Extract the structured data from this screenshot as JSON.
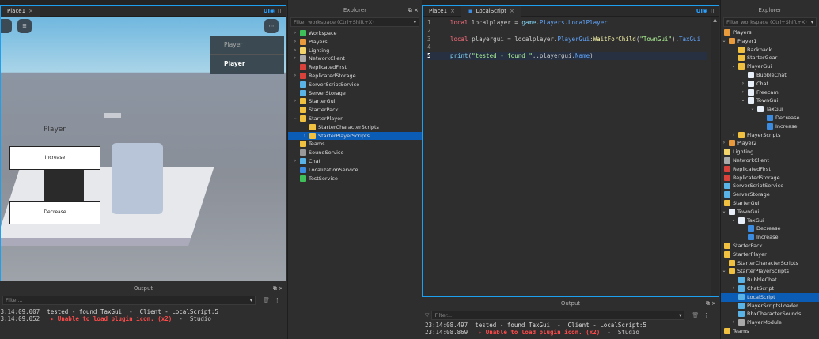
{
  "viewport": {
    "tab": "Place1",
    "ui_label": "UI",
    "menu_items": [
      "Player",
      "Player"
    ],
    "player_label": "Player",
    "buttons": {
      "increase": "Increase",
      "decrease": "Decrease"
    }
  },
  "explorer_mid": {
    "title": "Explorer",
    "filter_placeholder": "Filter workspace (Ctrl+Shift+X)",
    "items": [
      {
        "label": "Workspace",
        "depth": 0,
        "arrow": ">",
        "color": "#3fbf5a"
      },
      {
        "label": "Players",
        "depth": 0,
        "arrow": ">",
        "color": "#e89a3c"
      },
      {
        "label": "Lighting",
        "depth": 0,
        "arrow": ">",
        "color": "#f3d46a"
      },
      {
        "label": "NetworkClient",
        "depth": 0,
        "arrow": ">",
        "color": "#aaa"
      },
      {
        "label": "ReplicatedFirst",
        "depth": 0,
        "arrow": "",
        "color": "#d9423a"
      },
      {
        "label": "ReplicatedStorage",
        "depth": 0,
        "arrow": ">",
        "color": "#d9423a"
      },
      {
        "label": "ServerScriptService",
        "depth": 0,
        "arrow": "",
        "color": "#5ab3e6"
      },
      {
        "label": "ServerStorage",
        "depth": 0,
        "arrow": "",
        "color": "#5ab3e6"
      },
      {
        "label": "StarterGui",
        "depth": 0,
        "arrow": ">",
        "color": "#f0c040"
      },
      {
        "label": "StarterPack",
        "depth": 0,
        "arrow": "",
        "color": "#f0c040"
      },
      {
        "label": "StarterPlayer",
        "depth": 0,
        "arrow": "v",
        "color": "#f0c040"
      },
      {
        "label": "StarterCharacterScripts",
        "depth": 1,
        "arrow": "",
        "color": "#f0c040"
      },
      {
        "label": "StarterPlayerScripts",
        "depth": 1,
        "arrow": ">",
        "color": "#f0c040",
        "selected": true
      },
      {
        "label": "Teams",
        "depth": 0,
        "arrow": "",
        "color": "#f0c040"
      },
      {
        "label": "SoundService",
        "depth": 0,
        "arrow": "",
        "color": "#999"
      },
      {
        "label": "Chat",
        "depth": 0,
        "arrow": ">",
        "color": "#5ab3e6"
      },
      {
        "label": "LocalizationService",
        "depth": 0,
        "arrow": "",
        "color": "#3b8be0"
      },
      {
        "label": "TestService",
        "depth": 0,
        "arrow": "",
        "color": "#3fbf5a"
      }
    ]
  },
  "editor": {
    "tabs": [
      "Place1",
      "LocalScript"
    ],
    "ui_label": "UI",
    "lines": [
      {
        "n": "1",
        "tokens": [
          [
            "local",
            "#f86d7c"
          ],
          [
            " localplayer = ",
            "#ccc"
          ],
          [
            "game",
            "#84d6f7"
          ],
          [
            ".",
            "#ccc"
          ],
          [
            "Players",
            "#61a6ff"
          ],
          [
            ".",
            "#ccc"
          ],
          [
            "LocalPlayer",
            "#61a6ff"
          ]
        ]
      },
      {
        "n": "2",
        "tokens": []
      },
      {
        "n": "3",
        "tokens": [
          [
            "local",
            "#f86d7c"
          ],
          [
            " playergui = localplayer.",
            "#ccc"
          ],
          [
            "PlayerGui",
            "#61a6ff"
          ],
          [
            ":",
            "#ccc"
          ],
          [
            "WaitForChild",
            "#fdfbac"
          ],
          [
            "(",
            "#ccc"
          ],
          [
            "\"TownGui\"",
            "#adf195"
          ],
          [
            ").",
            "#ccc"
          ],
          [
            "TaxGui",
            "#61a6ff"
          ]
        ]
      },
      {
        "n": "4",
        "tokens": []
      },
      {
        "n": "5",
        "tokens": [
          [
            "print",
            "#84d6f7"
          ],
          [
            "(",
            "#ccc"
          ],
          [
            "\"tested - found \"",
            "#adf195"
          ],
          [
            "..playergui.",
            "#ccc"
          ],
          [
            "Name",
            "#61a6ff"
          ],
          [
            ")",
            "#ccc"
          ]
        ]
      }
    ]
  },
  "output_left": {
    "title": "Output",
    "filter_placeholder": "Filter...",
    "lines": [
      {
        "time": "23:14:09.007",
        "msg": "tested - found TaxGui  -  Client - LocalScript:5",
        "error": false
      },
      {
        "time": "23:14:09.052",
        "msg": "Unable to load plugin icon. (x2)",
        "suffix": "  -  Studio",
        "error": true
      }
    ]
  },
  "output_right": {
    "title": "Output",
    "filter_placeholder": "Filter...",
    "lines": [
      {
        "time": "23:14:08.497",
        "msg": "tested - found TaxGui  -  Client - LocalScript:5",
        "error": false
      },
      {
        "time": "23:14:08.869",
        "msg": "Unable to load plugin icon. (x2)",
        "suffix": "  -  Studio",
        "error": true
      }
    ]
  },
  "explorer_right": {
    "title": "Explorer",
    "filter_placeholder": "Filter workspace (Ctrl+Shift+X)",
    "items": [
      {
        "label": "Players",
        "depth": 0,
        "arrow": "",
        "color": "#e89a3c"
      },
      {
        "label": "Player1",
        "depth": 1,
        "arrow": "v",
        "color": "#e89a3c"
      },
      {
        "label": "Backpack",
        "depth": 3,
        "arrow": "",
        "color": "#f0c040"
      },
      {
        "label": "StarterGear",
        "depth": 3,
        "arrow": "",
        "color": "#f0c040"
      },
      {
        "label": "PlayerGui",
        "depth": 3,
        "arrow": "v",
        "color": "#f0c040"
      },
      {
        "label": "BubbleChat",
        "depth": 5,
        "arrow": "",
        "color": "#e8eef8"
      },
      {
        "label": "Chat",
        "depth": 5,
        "arrow": ">",
        "color": "#e8eef8"
      },
      {
        "label": "Freecam",
        "depth": 5,
        "arrow": ">",
        "color": "#e8eef8"
      },
      {
        "label": "TownGui",
        "depth": 5,
        "arrow": "v",
        "color": "#e8eef8"
      },
      {
        "label": "TaxGui",
        "depth": 7,
        "arrow": "v",
        "color": "#e8eef8"
      },
      {
        "label": "Decrease",
        "depth": 9,
        "arrow": "",
        "color": "#3b8be0"
      },
      {
        "label": "Increase",
        "depth": 9,
        "arrow": "",
        "color": "#3b8be0"
      },
      {
        "label": "PlayerScripts",
        "depth": 3,
        "arrow": ">",
        "color": "#f0c040"
      },
      {
        "label": "Player2",
        "depth": 1,
        "arrow": ">",
        "color": "#e89a3c"
      },
      {
        "label": "Lighting",
        "depth": 0,
        "arrow": "",
        "color": "#f3d46a"
      },
      {
        "label": "NetworkClient",
        "depth": 0,
        "arrow": "",
        "color": "#aaa"
      },
      {
        "label": "ReplicatedFirst",
        "depth": 0,
        "arrow": "",
        "color": "#d9423a"
      },
      {
        "label": "ReplicatedStorage",
        "depth": 0,
        "arrow": "",
        "color": "#d9423a"
      },
      {
        "label": "ServerScriptService",
        "depth": 0,
        "arrow": "",
        "color": "#5ab3e6"
      },
      {
        "label": "ServerStorage",
        "depth": 0,
        "arrow": "",
        "color": "#5ab3e6"
      },
      {
        "label": "StarterGui",
        "depth": 0,
        "arrow": "",
        "color": "#f0c040"
      },
      {
        "label": "TownGui",
        "depth": 1,
        "arrow": "v",
        "color": "#e8eef8"
      },
      {
        "label": "TaxGui",
        "depth": 3,
        "arrow": "v",
        "color": "#e8eef8"
      },
      {
        "label": "Decrease",
        "depth": 5,
        "arrow": "",
        "color": "#3b8be0"
      },
      {
        "label": "Increase",
        "depth": 5,
        "arrow": "",
        "color": "#3b8be0"
      },
      {
        "label": "StarterPack",
        "depth": 0,
        "arrow": "",
        "color": "#f0c040"
      },
      {
        "label": "StarterPlayer",
        "depth": 0,
        "arrow": "",
        "color": "#f0c040"
      },
      {
        "label": "StarterCharacterScripts",
        "depth": 1,
        "arrow": "",
        "color": "#f0c040"
      },
      {
        "label": "StarterPlayerScripts",
        "depth": 1,
        "arrow": "v",
        "color": "#f0c040"
      },
      {
        "label": "BubbleChat",
        "depth": 3,
        "arrow": "",
        "color": "#5ab3e6"
      },
      {
        "label": "ChatScript",
        "depth": 3,
        "arrow": ">",
        "color": "#5ab3e6"
      },
      {
        "label": "LocalScript",
        "depth": 3,
        "arrow": "",
        "color": "#5ab3e6",
        "selected": true
      },
      {
        "label": "PlayerScriptsLoader",
        "depth": 3,
        "arrow": "",
        "color": "#5ab3e6"
      },
      {
        "label": "RbxCharacterSounds",
        "depth": 3,
        "arrow": "",
        "color": "#5ab3e6"
      },
      {
        "label": "PlayerModule",
        "depth": 3,
        "arrow": ">",
        "color": "#aaa"
      },
      {
        "label": "Teams",
        "depth": 0,
        "arrow": "",
        "color": "#f0c040"
      }
    ]
  }
}
